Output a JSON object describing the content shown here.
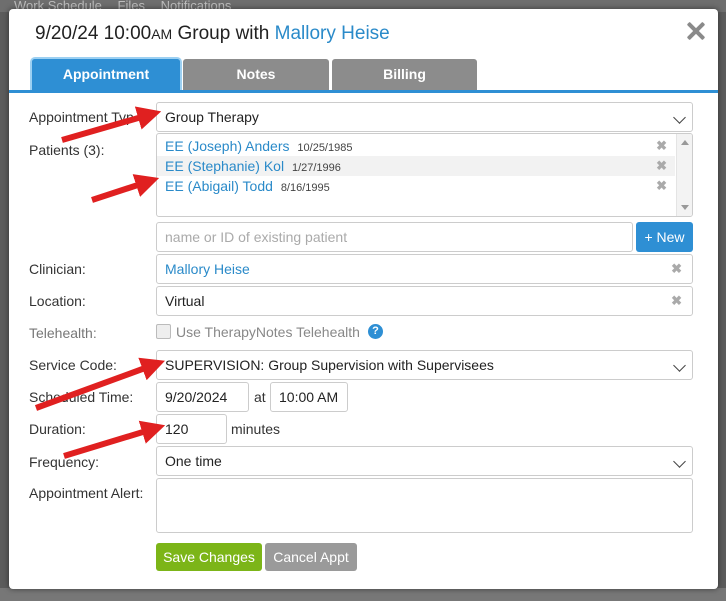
{
  "background": {
    "tabs": [
      "Work Schedule",
      "Files",
      "Notifications"
    ]
  },
  "dialog": {
    "date_time": "9/20/24 10:00",
    "ampm": "AM",
    "title_text": "Group with",
    "clinician_name": "Mallory Heise",
    "tabs": [
      {
        "label": "Appointment",
        "active": true
      },
      {
        "label": "Notes",
        "active": false
      },
      {
        "label": "Billing",
        "active": false
      }
    ]
  },
  "form": {
    "appointment_type": {
      "label": "Appointment Typ",
      "value": "Group Therapy"
    },
    "patients": {
      "label": "Patients (3):",
      "items": [
        {
          "name": "EE (Joseph) Anders",
          "dob": "10/25/1985"
        },
        {
          "name": "EE (Stephanie) Kol",
          "dob": "1/27/1996"
        },
        {
          "name": "EE (Abigail) Todd",
          "dob": "8/16/1995"
        }
      ],
      "search_placeholder": "name or ID of existing patient",
      "new_button": "+ New"
    },
    "clinician": {
      "label": "Clinician:",
      "value": "Mallory Heise"
    },
    "location": {
      "label": "Location:",
      "value": "Virtual"
    },
    "telehealth": {
      "label": "Telehealth:",
      "checkbox_label": "Use TherapyNotes Telehealth",
      "checked": false
    },
    "service_code": {
      "label": "Service Code:",
      "value": "SUPERVISION: Group Supervision with Supervisees"
    },
    "scheduled_time": {
      "label": "Scheduled Time:",
      "date": "9/20/2024",
      "at": "at",
      "time": "10:00 AM"
    },
    "duration": {
      "label": "Duration:",
      "value": "120",
      "unit": "minutes"
    },
    "frequency": {
      "label": "Frequency:",
      "value": "One time"
    },
    "appointment_alert": {
      "label": "Appointment Alert:",
      "value": ""
    },
    "buttons": {
      "save": "Save Changes",
      "cancel": "Cancel Appt"
    }
  },
  "colors": {
    "accent": "#2e8fd4",
    "link": "#2a8ac9",
    "save": "#7cb518",
    "cancel": "#9a9a9a",
    "annotation_arrow": "#e02020"
  }
}
